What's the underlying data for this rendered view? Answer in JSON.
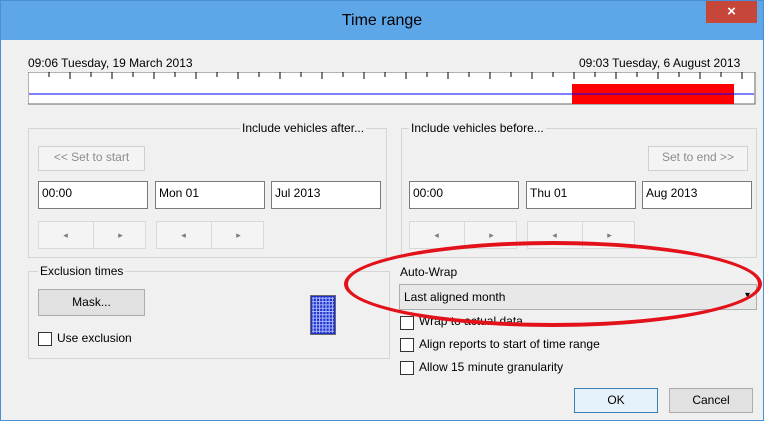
{
  "window": {
    "title": "Time range",
    "close": "×"
  },
  "timeline": {
    "start_label": "09:06 Tuesday, 19 March 2013",
    "end_label": "09:03 Tuesday, 6 August 2013",
    "highlight_color": "#ff0000",
    "line_color": "#0000ff"
  },
  "after": {
    "group_label": "Include vehicles after...",
    "set_button": "<< Set to start",
    "time": "00:00",
    "day": "Mon 01",
    "month": "Jul 2013"
  },
  "before": {
    "group_label": "Include vehicles before...",
    "set_button": "Set to end >>",
    "time": "00:00",
    "day": "Thu 01",
    "month": "Aug 2013"
  },
  "spin_arrows": {
    "left": "◂",
    "right": "▸"
  },
  "exclusion": {
    "group_label": "Exclusion times",
    "mask_button": "Mask...",
    "use_exclusion": "Use exclusion"
  },
  "autowrap": {
    "label": "Auto-Wrap",
    "selected": "Last aligned month",
    "options": [
      {
        "label": "Wrap to actual data",
        "checked": false
      },
      {
        "label": "Align reports to start of time range",
        "checked": false
      },
      {
        "label": "Allow 15 minute granularity",
        "checked": false
      }
    ]
  },
  "buttons": {
    "ok": "OK",
    "cancel": "Cancel"
  },
  "annotation_color": "#e2111a"
}
